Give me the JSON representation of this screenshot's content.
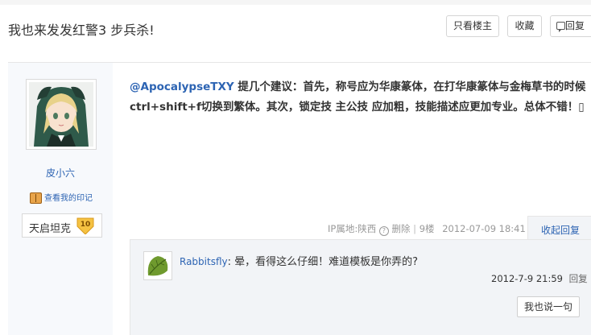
{
  "thread": {
    "title": "我也来发发红警3 步兵杀!"
  },
  "header_buttons": {
    "only_author": "只看楼主",
    "favorite": "收藏",
    "reply": "回复"
  },
  "author": {
    "name": "皮小六",
    "my_mark": "查看我的印记",
    "badge_name": "天启坦克",
    "badge_level": "10"
  },
  "post": {
    "mention": "@ApocalypseTXY",
    "text": " 提几个建议：首先，称号应为华康篆体，在打华康篆体与金梅草书的时候ctrl+shift+f切换到繁体。其次，锁定技 主公技 应加粗，技能描述应更加专业。总体不错！",
    "emoticon": "▯"
  },
  "post_tail": {
    "ip_location": "IP属地:陕西",
    "help_icon": "?",
    "delete": "删除",
    "separator": "|",
    "floor": "9楼",
    "time": "2012-07-09 18:41",
    "collapse": "收起回复"
  },
  "sub_reply": {
    "user": "Rabbitsfly",
    "text": ": 晕，看得这么仔细！难道模板是你弄的?",
    "time": "2012-7-9 21:59",
    "reply": "回复",
    "say_button": "我也说一句"
  },
  "icons": {
    "reply": "speech-bubble-icon",
    "help": "question-circle-icon",
    "mark": "book-icon",
    "level": "level-badge-icon"
  },
  "colors": {
    "link": "#2d64b3",
    "badge_gold": "#f5c242"
  }
}
